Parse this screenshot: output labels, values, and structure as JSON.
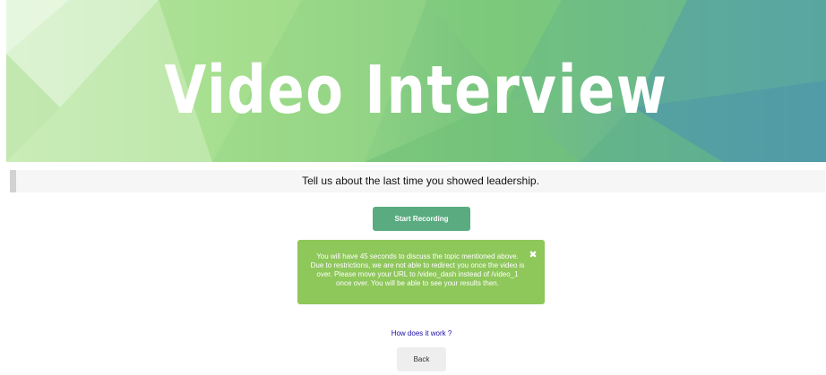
{
  "banner": {
    "title": "Video Interview"
  },
  "question": {
    "text": "Tell us about the last time you showed leadership."
  },
  "controls": {
    "start_label": "Start Recording",
    "back_label": "Back",
    "how_link": "How does it work ?"
  },
  "alert": {
    "message": "You will have 45 seconds to discuss the topic mentioned above. Due to restrictions, we are not able to redirect you once the video is over. Please move your URL to /video_dash instead of /video_1 once over. You will be able to see your results then.",
    "close_glyph": "✖"
  },
  "colors": {
    "start_button": "#5aac80",
    "alert_background": "#8ec75a",
    "link": "#1a0dab"
  }
}
